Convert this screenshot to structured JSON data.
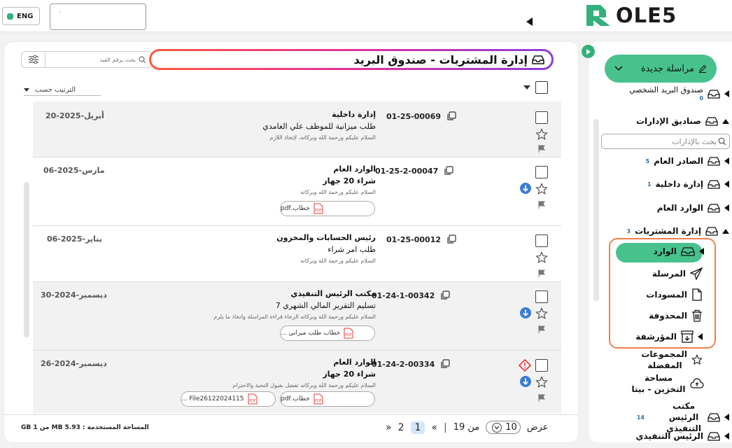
{
  "topbar": {
    "language": "ENG",
    "search_value": "·",
    "logo_text": "OLE5"
  },
  "colors": {
    "accent_green": "#48c28d",
    "highlight_orange": "#f07f4a",
    "info_blue": "#3a7bd5",
    "warning_red": "#e53935"
  },
  "main": {
    "title": "إدارة المشتريات - صندوق البريد",
    "filter_placeholder": "بحث برقم القيد",
    "sort_label": "الترتيب حسب",
    "rows": [
      {
        "doc_no": "01-25-00069",
        "date": "20-أبريل-2025",
        "sender": "إدارة داخلية",
        "subject": "طلب ميزانية للموظف علي الغامدي",
        "preview": "السلام عليكم ورحمة الله وبركاته، لإتخاذ اللازم",
        "attachments": []
      },
      {
        "doc_no": "01-25-2-00047",
        "date": "06-مارس-2025",
        "sender": "الوارد العام",
        "subject": "شراء 20 جهاز",
        "preview": "السلام عليكم ورحمة الله وبركاته",
        "attachments": [
          "خطاب.pdf"
        ]
      },
      {
        "doc_no": "01-25-00012",
        "date": "06-يناير-2025",
        "sender": "رئيس الحسابات والمخزون",
        "subject": "طلب امر شراء",
        "preview": "السلام عليكم ورحمة الله وبركاته",
        "attachments": []
      },
      {
        "doc_no": "01-24-1-00342",
        "date": "30-ديسمبر-2024",
        "sender": "مكتب الرئيس التنفيذي",
        "subject": "تسليم التقرير المالي الشهري 7",
        "preview": "السلام عليكم ورحمة الله وبركاته الرجاء قراءة المراسلة واتخاذ ما يلزم",
        "attachments": [
          "خطاب طلب ميزاني ..."
        ]
      },
      {
        "doc_no": "01-24-2-00334",
        "date": "26-ديسمبر-2024",
        "sender": "الوارد العام",
        "subject": "شراء 20 جهاز",
        "preview": "السلام عليكم ورحمة الله وبركاته تفضل بقبول التحية والاحترام",
        "attachments": [
          "خطاب.pdf",
          "File26122024115 ..."
        ]
      }
    ]
  },
  "footer": {
    "storage": "المساحة المستخدمة : 5.93 MB من 1 GB",
    "show_label": "عرض",
    "page_size": "10",
    "of_label": "من 19",
    "first": "«",
    "current_page": "1",
    "next_page": "2",
    "last": "»"
  },
  "sidebar": {
    "new_message": "مراسلة جديدة",
    "personal_inbox": "صندوق البريد الشخصي",
    "personal_inbox_badge": "0",
    "dept_boxes": "صناديق الإدارات",
    "dept_search_placeholder": "بحث بالإدارات",
    "outgoing_general": "الصادر العام",
    "outgoing_general_badge": "5",
    "internal_dept": "إدارة داخلية",
    "internal_dept_badge": "1",
    "incoming_general": "الوارد العام",
    "procurement": "إدارة المشتريات",
    "procurement_badge": "3",
    "inbox": "الوارد",
    "sent": "المرسلة",
    "drafts": "المسودات",
    "deleted": "المحذوفة",
    "archived": "المؤرشفة",
    "favorites": "المجموعات المفضلة",
    "storage_beta": "مساحة التخزين - بيتا",
    "ceo_office": "مكتب الرئيس التنفيذي",
    "ceo_office_badge": "14",
    "ceo": "الرئيس التنفيذي"
  }
}
